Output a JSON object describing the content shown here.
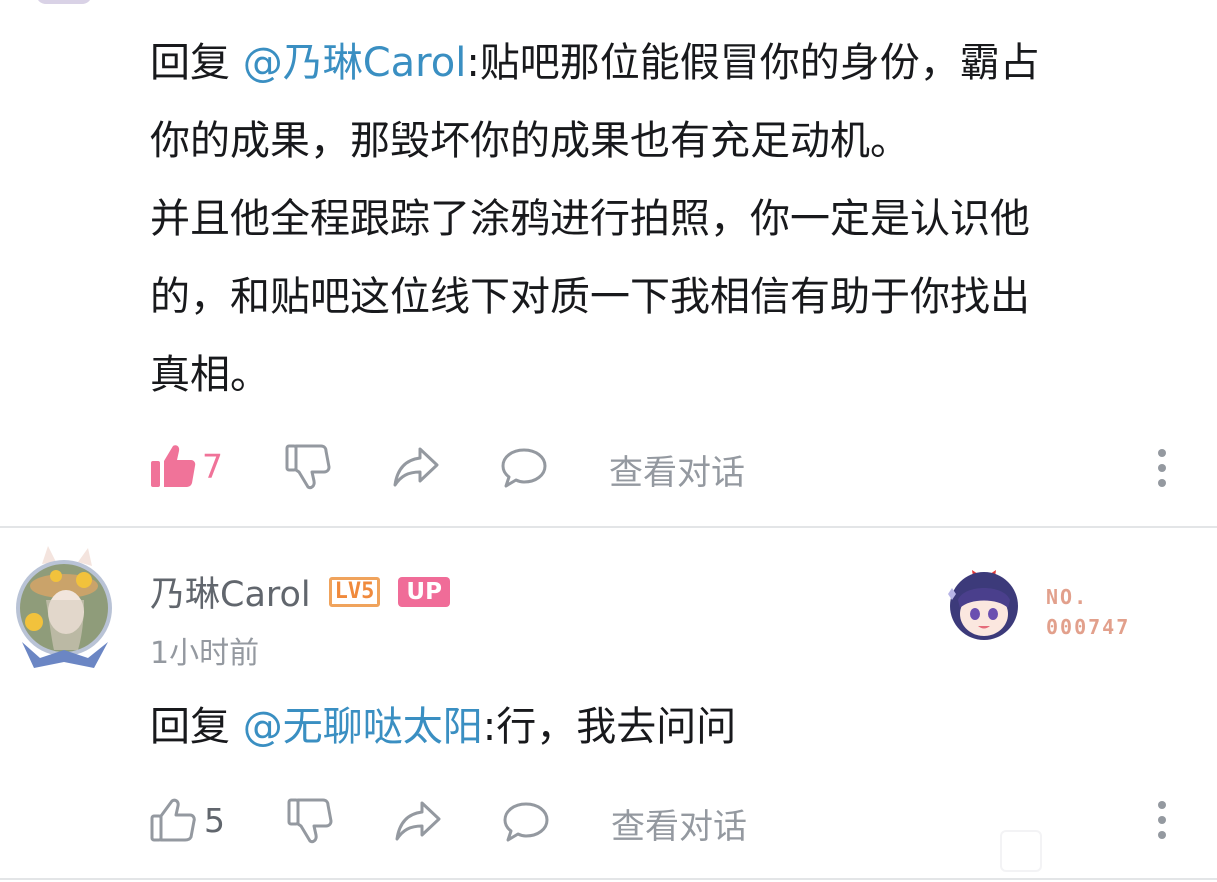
{
  "comment1": {
    "reply_prefix": "回复 ",
    "mention": "@乃琳Carol",
    "lines": [
      ":贴吧那位能假冒你的身份，霸占",
      "你的成果，那毁坏你的成果也有充足动机。",
      "并且他全程跟踪了涂鸦进行拍照，你一定是认识他",
      "的，和贴吧这位线下对质一下我相信有助于你找出",
      "真相。"
    ],
    "like_count": "7",
    "liked": true,
    "view_dialog": "查看对话"
  },
  "comment2": {
    "username": "乃琳Carol",
    "level_badge": "LV5",
    "up_badge": "UP",
    "time": "1小时前",
    "fan_label": "NO.",
    "fan_number": "000747",
    "reply_prefix": "回复 ",
    "mention": "@无聊哒太阳",
    "text": ":行，我去问问",
    "like_count": "5",
    "liked": false,
    "view_dialog": "查看对话"
  },
  "colors": {
    "mention": "#3a8fc2",
    "like_active": "#f07399",
    "icon_gray": "#9499a0",
    "up_badge": "#f06c98",
    "level_badge": "#f08a3c"
  },
  "icons": [
    "thumb-up-icon",
    "thumb-down-icon",
    "share-icon",
    "comment-icon",
    "more-icon"
  ]
}
